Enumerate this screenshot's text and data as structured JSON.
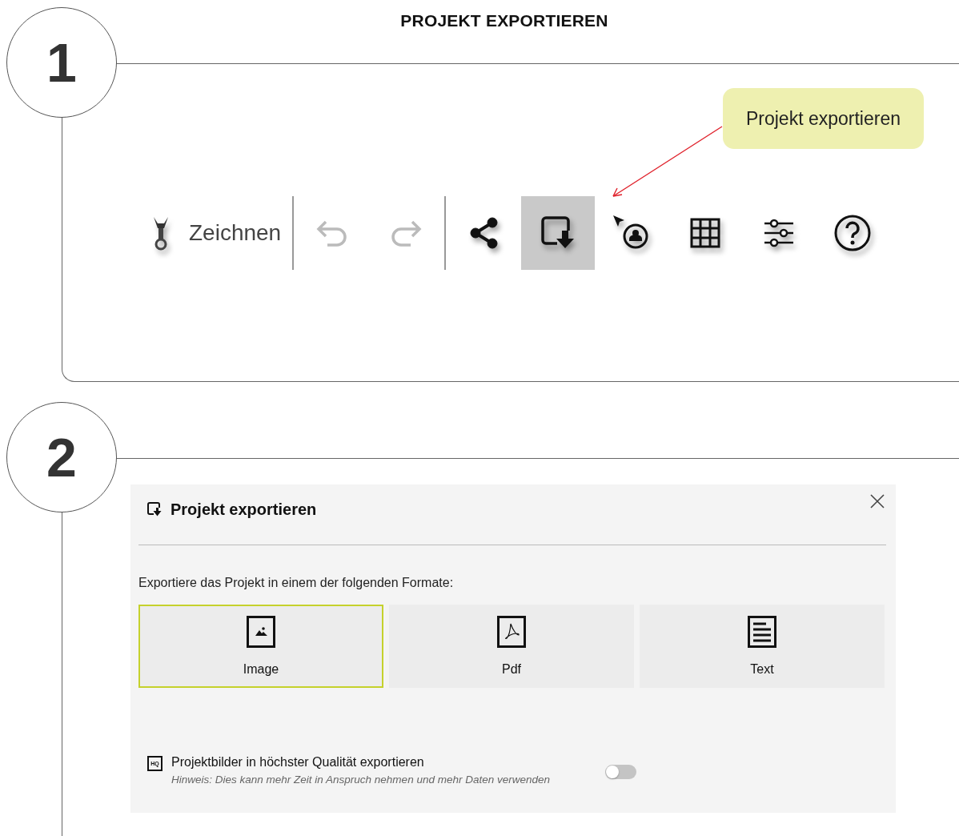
{
  "title": "PROJEKT EXPORTIEREN",
  "step_1": {
    "number": "1",
    "callout": "Projekt exportieren",
    "toolbar": {
      "groups": [
        [
          {
            "kind": "draw",
            "label": "Zeichnen",
            "selected": false,
            "disabled": false
          }
        ],
        [
          {
            "kind": "undo",
            "selected": false,
            "disabled": true
          },
          {
            "kind": "redo",
            "selected": false,
            "disabled": true
          }
        ],
        [
          {
            "kind": "share",
            "selected": false,
            "disabled": false
          },
          {
            "kind": "export",
            "selected": true,
            "disabled": false
          },
          {
            "kind": "locate",
            "selected": false,
            "disabled": false
          },
          {
            "kind": "grid",
            "selected": false,
            "disabled": false
          },
          {
            "kind": "sliders",
            "selected": false,
            "disabled": false
          },
          {
            "kind": "help",
            "selected": false,
            "disabled": false
          }
        ]
      ]
    }
  },
  "step_2": {
    "number": "2",
    "dialog": {
      "title": "Projekt exportieren",
      "description": "Exportiere das Projekt in einem der folgenden Formate:",
      "formats": [
        {
          "kind": "image",
          "label": "Image",
          "selected": true
        },
        {
          "kind": "pdf",
          "label": "Pdf",
          "selected": false
        },
        {
          "kind": "text",
          "label": "Text",
          "selected": false
        }
      ],
      "option": {
        "badge": "HQ",
        "label": "Projektbilder in höchster Qualität exportieren",
        "hint": "Hinweis: Dies kann mehr Zeit in Anspruch nehmen und mehr Daten verwenden",
        "on": false
      }
    }
  }
}
